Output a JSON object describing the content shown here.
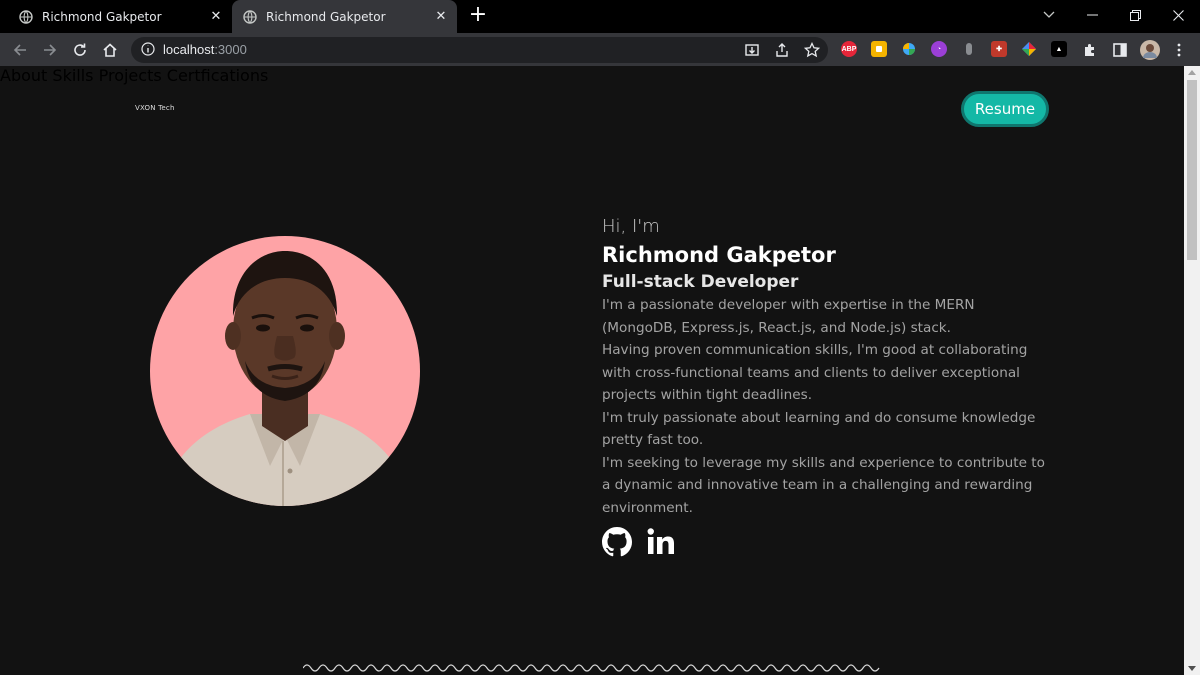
{
  "browser": {
    "tabs": [
      {
        "title": "Richmond Gakpetor",
        "active": false
      },
      {
        "title": "Richmond Gakpetor",
        "active": true
      }
    ],
    "url_host": "localhost",
    "url_port": ":3000",
    "extensions": [
      {
        "name": "adblock-plus",
        "label": "ABP",
        "color": "#e6263a"
      },
      {
        "name": "keep",
        "label": "",
        "color": "#f5b400"
      },
      {
        "name": "colorful-ext",
        "label": "",
        "color": "#6b6b6b"
      },
      {
        "name": "purple-ext",
        "label": "",
        "color": "#9b3fd6"
      },
      {
        "name": "grey-ext",
        "label": "",
        "color": "#6a6a6a"
      },
      {
        "name": "red-ext",
        "label": "",
        "color": "#c0392b"
      },
      {
        "name": "multicolor-ext",
        "label": "",
        "color": "#4a8df0"
      },
      {
        "name": "triangle-ext",
        "label": "",
        "color": "#000000"
      }
    ]
  },
  "header": {
    "logo": "VXON Tech",
    "nav": [
      "About",
      "Skills",
      "Projects",
      "Certfications"
    ],
    "resume_label": "Resume"
  },
  "hero": {
    "greeting": "Hi, I'm",
    "name": "Richmond Gakpetor",
    "role": "Full-stack Developer",
    "bio": [
      "I'm a passionate developer with expertise in the MERN (MongoDB, Express.js, React.js, and Node.js) stack.",
      "Having proven communication skills, I'm good at collaborating with cross-functional teams and clients to deliver exceptional projects within tight deadlines.",
      "I'm truly passionate about learning and do consume knowledge pretty fast too.",
      "I'm seeking to leverage my skills and experience to contribute to a dynamic and innovative team in a challenging and rewarding environment."
    ],
    "socials": [
      "github-icon",
      "linkedin-icon"
    ]
  },
  "colors": {
    "accent": "#14b8a6",
    "avatar_bg": "#fea3a6",
    "page_bg": "#121212"
  }
}
